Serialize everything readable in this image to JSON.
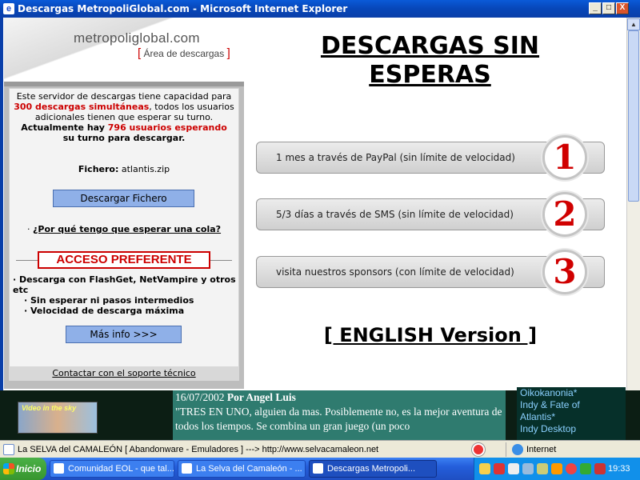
{
  "window": {
    "title": "Descargas MetropoliGlobal.com - Microsoft Internet Explorer",
    "controls": {
      "minimize": "_",
      "maximize": "□",
      "close": "X"
    }
  },
  "logo": {
    "name_prefix": "metropoli",
    "name_mid": "global",
    "name_suffix": ".com",
    "subtitle_open": "[",
    "subtitle": " Área de descargas ",
    "subtitle_close": "]"
  },
  "left": {
    "intro_1": "Este servidor de descargas tiene capacidad para",
    "intro_highlight": "300 descargas simultáneas",
    "intro_2": ", todos los usuarios adicionales tienen que esperar su turno.",
    "waiting_prefix": "Actualmente hay ",
    "waiting_highlight": "796 usuarios esperando",
    "waiting_suffix": "su turno para descargar.",
    "file_label": "Fichero:",
    "file_name": "atlantis.zip",
    "download_button": "Descargar Fichero",
    "why_link": "¿Por qué tengo que esperar una cola?",
    "acceso": "ACCESO PREFERENTE",
    "features": [
      "· Descarga con FlashGet, NetVampire y otros etc",
      "· Sin esperar ni pasos intermedios",
      "· Velocidad de descarga máxima"
    ],
    "more_button": "Más info >>>",
    "support_link": "Contactar con el soporte técnico"
  },
  "main": {
    "headline": "DESCARGAS SIN ESPERAS",
    "options": [
      {
        "label": "1 mes a través de PayPal (sin límite de velocidad)",
        "number": "1"
      },
      {
        "label": "5/3 días a través de SMS (sin límite de velocidad)",
        "number": "2"
      },
      {
        "label": "visita nuestros sponsors (con límite de velocidad)",
        "number": "3"
      }
    ],
    "english_link": "[ ENGLISH Version ]"
  },
  "underlying": {
    "date": "16/07/2002",
    "author": "Por Angel Luis",
    "text": "\"TRES EN UNO, alguien da mas. Posiblemente no, es la mejor aventura de todos los tiempos. Se combina un gran juego (un poco",
    "right_lines": [
      "Oikokanonia*",
      "Indy & Fate of",
      "Atlantis*",
      "Indy Desktop"
    ],
    "image_caption": "Video in the sky"
  },
  "statusbar": {
    "left": "La SELVA del CAMALEÓN [ Abandonware - Emuladores ] ---> http://www.selvacamaleon.net",
    "zone": "Internet"
  },
  "taskbar": {
    "start": "Inicio",
    "tasks": [
      "Comunidad EOL - que tal...",
      "La Selva del Camaleón - ...",
      "Descargas Metropoli..."
    ],
    "clock": "19:33"
  },
  "colors": {
    "accent_red": "#cc0000",
    "title_blue": "#0a5ad8",
    "taskbar_blue": "#245edb"
  }
}
